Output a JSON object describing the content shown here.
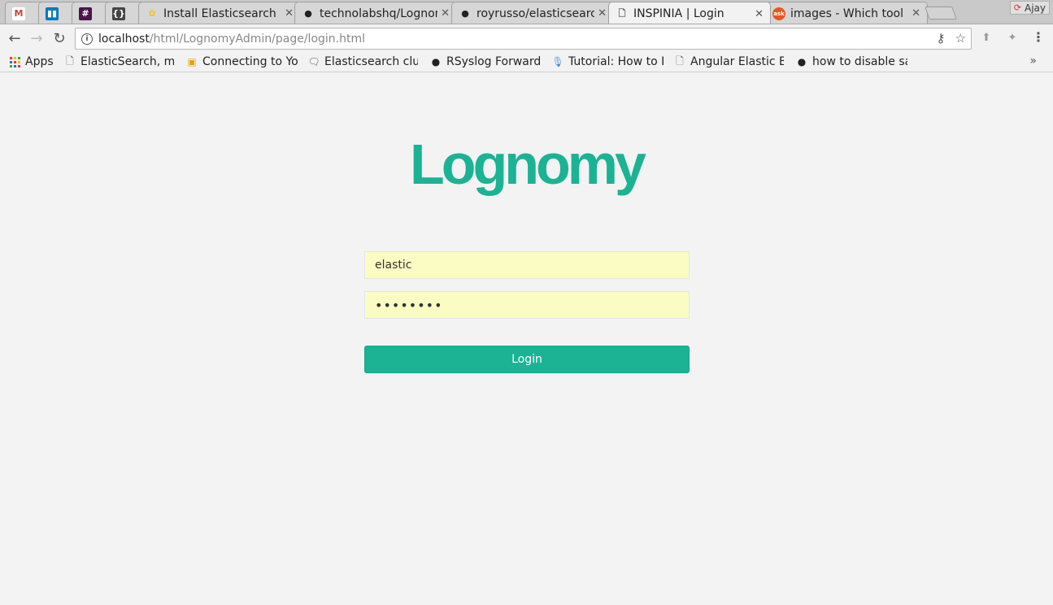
{
  "tabs": [
    {
      "title": "",
      "icon": "gmail-icon",
      "glyph": "M",
      "color": "#d23f31",
      "bg": "#ffffff"
    },
    {
      "title": "",
      "icon": "trello-icon",
      "glyph": "▮▮",
      "color": "#ffffff",
      "bg": "#0079bf"
    },
    {
      "title": "",
      "icon": "slack-hash-icon",
      "glyph": "#",
      "color": "#ffffff",
      "bg": "#4a154b"
    },
    {
      "title": "",
      "icon": "json-braces-icon",
      "glyph": "{}",
      "color": "#ffffff",
      "bg": "#444444"
    },
    {
      "title": "Install Elasticsearch",
      "icon": "elastic-icon",
      "glyph": "✿",
      "color": "#f3c400",
      "bg": "transparent"
    },
    {
      "title": "technolabshq/Lognomy",
      "icon": "github-icon",
      "glyph": "●",
      "color": "#222222",
      "bg": "transparent"
    },
    {
      "title": "royrusso/elasticsearch",
      "icon": "github-icon",
      "glyph": "●",
      "color": "#222222",
      "bg": "transparent"
    },
    {
      "title": "INSPINIA | Login",
      "icon": "page-icon",
      "glyph": "🗋",
      "color": "#555555",
      "bg": "transparent"
    },
    {
      "title": "images - Which tool",
      "icon": "askubuntu-icon",
      "glyph": "ask",
      "color": "#ffffff",
      "bg": "#e95420"
    }
  ],
  "profile": {
    "name": "Ajay"
  },
  "address": {
    "host": "localhost",
    "path": "/html/LognomyAdmin/page/login.html"
  },
  "bookmarks": [
    {
      "label": "Apps",
      "icon": "apps-grid-icon"
    },
    {
      "label": "ElasticSearch, ma",
      "icon": "page-icon"
    },
    {
      "label": "Connecting to Yo",
      "icon": "box-icon"
    },
    {
      "label": "Elasticsearch clu",
      "icon": "comment-icon"
    },
    {
      "label": "RSyslog Forwardi",
      "icon": "github-icon"
    },
    {
      "label": "Tutorial: How to I",
      "icon": "mic-icon"
    },
    {
      "label": "Angular Elastic B",
      "icon": "page-icon"
    },
    {
      "label": "how to disable sa",
      "icon": "github-icon"
    }
  ],
  "page": {
    "logo": "Lognomy",
    "username": "elastic",
    "password": "••••••••",
    "login_label": "Login"
  },
  "colors": {
    "brand": "#1ab394",
    "autofill": "#fafcc4"
  }
}
